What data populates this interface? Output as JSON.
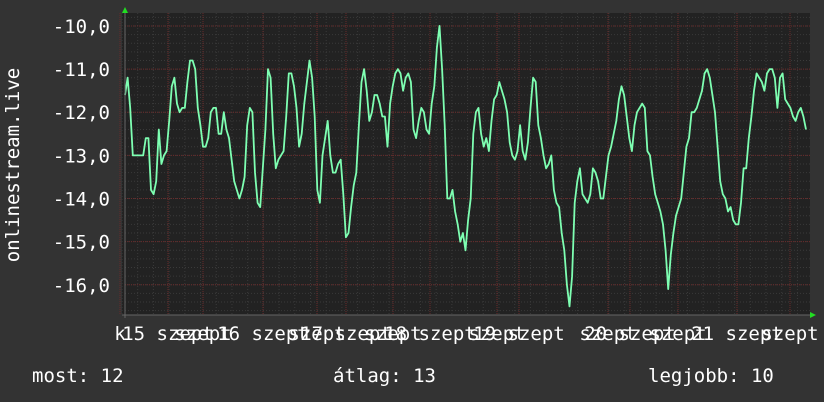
{
  "chart_data": {
    "type": "line",
    "ylabel": "onlinestream.live",
    "ylim": [
      -16.7,
      -9.7
    ],
    "y_ticks": [
      "-10,0",
      "-11,0",
      "-12,0",
      "-13,0",
      "-14,0",
      "-15,0",
      "-16,0"
    ],
    "y_tick_values": [
      -10,
      -11,
      -12,
      -13,
      -14,
      -15,
      -16
    ],
    "x_tick_labels": [
      "k",
      "15 szept",
      "szept",
      "16 szept",
      "szept",
      "17 szept",
      "szept",
      "18 szept",
      "szept",
      "19 szept",
      "szept",
      "20 szept",
      "szept",
      "21 szept",
      "szept"
    ],
    "grid": true,
    "colors": {
      "background": "#333333",
      "plot_background": "#222222",
      "major_grid": "#6b2a2a",
      "minor_grid": "#3a3a3a",
      "line": "#7effb2",
      "axis_arrow": "#22dd22",
      "text": "#ffffff"
    },
    "series": [
      {
        "values": [
          -11.6,
          -11.2,
          -11.9,
          -13.0,
          -13.0,
          -13.0,
          -13.0,
          -13.0,
          -12.6,
          -12.6,
          -13.8,
          -13.9,
          -13.6,
          -12.4,
          -13.2,
          -13.0,
          -12.9,
          -12.2,
          -11.4,
          -11.2,
          -11.8,
          -12.0,
          -11.9,
          -11.9,
          -11.3,
          -10.8,
          -10.8,
          -11.0,
          -11.9,
          -12.3,
          -12.8,
          -12.8,
          -12.6,
          -12.0,
          -11.9,
          -11.9,
          -12.5,
          -12.5,
          -12.0,
          -12.4,
          -12.6,
          -13.1,
          -13.6,
          -13.8,
          -14.0,
          -13.8,
          -13.5,
          -12.3,
          -11.9,
          -12.0,
          -13.4,
          -14.1,
          -14.2,
          -13.3,
          -12.4,
          -11.0,
          -11.2,
          -12.5,
          -13.3,
          -13.1,
          -13.0,
          -12.9,
          -12.1,
          -11.1,
          -11.1,
          -11.4,
          -11.9,
          -12.8,
          -12.5,
          -11.8,
          -11.3,
          -10.8,
          -11.2,
          -12.1,
          -13.8,
          -14.1,
          -13.0,
          -12.6,
          -12.2,
          -13.0,
          -13.4,
          -13.4,
          -13.2,
          -13.1,
          -13.9,
          -14.9,
          -14.8,
          -14.2,
          -13.7,
          -13.4,
          -12.3,
          -11.3,
          -11.0,
          -11.5,
          -12.2,
          -12.0,
          -11.6,
          -11.6,
          -11.8,
          -12.1,
          -12.1,
          -12.8,
          -11.8,
          -11.4,
          -11.1,
          -11.0,
          -11.1,
          -11.5,
          -11.2,
          -11.1,
          -11.3,
          -12.4,
          -12.6,
          -12.2,
          -11.9,
          -12.0,
          -12.4,
          -12.5,
          -11.8,
          -11.4,
          -10.5,
          -10.0,
          -11.0,
          -12.3,
          -14.0,
          -14.0,
          -13.8,
          -14.3,
          -14.6,
          -15.0,
          -14.8,
          -15.2,
          -14.5,
          -14.0,
          -12.5,
          -12.0,
          -11.9,
          -12.5,
          -12.8,
          -12.6,
          -12.9,
          -12.2,
          -11.7,
          -11.6,
          -11.3,
          -11.5,
          -11.7,
          -12.0,
          -12.7,
          -13.0,
          -13.1,
          -12.9,
          -12.3,
          -12.9,
          -13.1,
          -12.7,
          -11.9,
          -11.2,
          -11.3,
          -12.3,
          -12.6,
          -13.0,
          -13.3,
          -13.2,
          -13.0,
          -13.8,
          -14.1,
          -14.2,
          -14.8,
          -15.2,
          -16.0,
          -16.5,
          -15.8,
          -14.1,
          -13.6,
          -13.3,
          -13.9,
          -14.0,
          -14.1,
          -13.9,
          -13.3,
          -13.4,
          -13.6,
          -14.0,
          -14.0,
          -13.5,
          -13.0,
          -12.8,
          -12.5,
          -12.2,
          -11.7,
          -11.4,
          -11.6,
          -12.1,
          -12.6,
          -12.9,
          -12.3,
          -12.0,
          -11.9,
          -11.8,
          -11.9,
          -12.9,
          -13.0,
          -13.5,
          -13.9,
          -14.1,
          -14.3,
          -14.6,
          -15.2,
          -16.1,
          -15.3,
          -14.8,
          -14.4,
          -14.2,
          -14.0,
          -13.4,
          -12.8,
          -12.6,
          -12.0,
          -12.0,
          -11.9,
          -11.7,
          -11.5,
          -11.1,
          -11.0,
          -11.2,
          -11.6,
          -12.0,
          -12.8,
          -13.6,
          -13.9,
          -14.0,
          -14.3,
          -14.2,
          -14.5,
          -14.6,
          -14.6,
          -14.1,
          -13.3,
          -13.3,
          -12.6,
          -12.1,
          -11.5,
          -11.1,
          -11.2,
          -11.3,
          -11.5,
          -11.1,
          -11.0,
          -11.0,
          -11.2,
          -11.9,
          -11.2,
          -11.1,
          -11.7,
          -11.8,
          -11.9,
          -12.1,
          -12.2,
          -12.0,
          -11.9,
          -12.1,
          -12.4
        ],
        "color": "#7effb2"
      }
    ],
    "stats": {
      "current": "most: 12",
      "average": "átlag: 13",
      "best": "legjobb: 10"
    }
  }
}
